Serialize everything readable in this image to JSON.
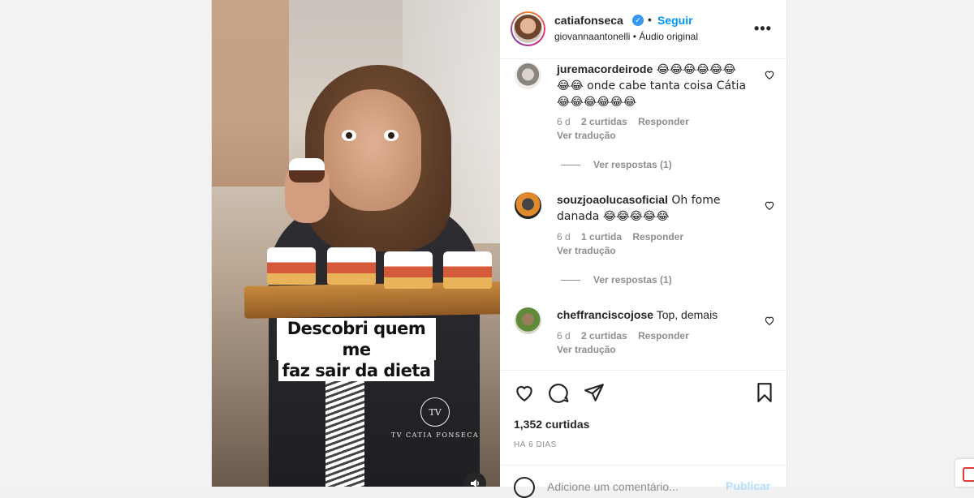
{
  "post": {
    "caption_lines": [
      "Descobri quem me",
      "faz sair da dieta"
    ],
    "watermark_logo": "TV",
    "watermark_text": "TV CATIA FONSECA"
  },
  "header": {
    "username": "catiafonseca",
    "follow_label": "Seguir",
    "dot": "•",
    "subline": "giovannaantonelli • Áudio original",
    "more_label": "•••"
  },
  "comments": [
    {
      "user": "juremacordeirode",
      "text": " 😂😂😂😂😂😂😂😂 onde cabe tanta coisa Cátia 😂😂😂😂😂😂",
      "age": "6 d",
      "likes": "2 curtidas",
      "reply": "Responder",
      "translate": "Ver tradução",
      "view_replies": "Ver respostas (1)"
    },
    {
      "user": "souzjoaolucasoficial",
      "text": " Oh fome danada 😂😂😂😂😂",
      "age": "6 d",
      "likes": "1 curtida",
      "reply": "Responder",
      "translate": "Ver tradução",
      "view_replies": "Ver respostas (1)"
    },
    {
      "user": "cheffranciscojose",
      "text": " Top, demais",
      "age": "6 d",
      "likes": "2 curtidas",
      "reply": "Responder",
      "translate": "Ver tradução"
    }
  ],
  "actions": {
    "likes_count": "1,352 curtidas",
    "date": "HÁ 6 DIAS"
  },
  "add_comment": {
    "placeholder": "Adicione um comentário...",
    "publish_label": "Publicar"
  },
  "colors": {
    "accent": "#0095f6",
    "verified": "#3897f0",
    "muted": "#8e8e8e"
  }
}
